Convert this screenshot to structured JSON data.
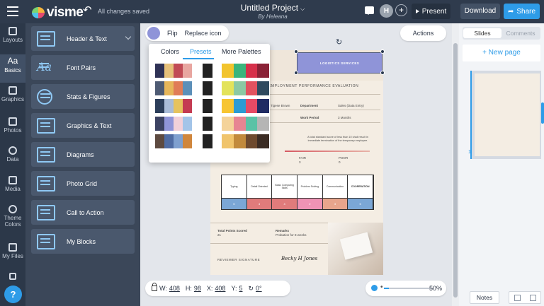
{
  "topbar": {
    "logo_text": "visme",
    "save_status": "All changes saved",
    "project_title": "Untitled Project",
    "project_author": "By Heleana",
    "avatar_initial": "H",
    "present_label": "Present",
    "download_label": "Download",
    "share_label": "Share"
  },
  "sidebar": {
    "items": [
      {
        "label": "Layouts"
      },
      {
        "label": "Basics"
      },
      {
        "label": "Graphics"
      },
      {
        "label": "Photos"
      },
      {
        "label": "Data"
      },
      {
        "label": "Media"
      },
      {
        "label": "Theme Colors"
      },
      {
        "label": "My Files"
      }
    ],
    "help_label": "?"
  },
  "panel": {
    "cards": [
      {
        "label": "Header & Text"
      },
      {
        "label": "Font Pairs"
      },
      {
        "label": "Stats & Figures"
      },
      {
        "label": "Graphics & Text"
      },
      {
        "label": "Diagrams"
      },
      {
        "label": "Photo Grid"
      },
      {
        "label": "Call to Action"
      },
      {
        "label": "My Blocks"
      }
    ]
  },
  "toolbar": {
    "flip_label": "Flip",
    "replace_icon_label": "Replace icon",
    "actions_label": "Actions",
    "selected_color": "#8f94d8"
  },
  "color_popover": {
    "tabs": [
      "Colors",
      "Presets",
      "More Palettes"
    ],
    "active_tab": "Presets",
    "palettes": [
      {
        "left": [
          "#2f3256",
          "#e6c07a",
          "#c14b55",
          "#e8a6a0"
        ],
        "mid": [
          "#222222"
        ],
        "right": [
          "#f2c42d",
          "#3ab57c",
          "#d6304a",
          "#8a2236"
        ]
      },
      {
        "left": [
          "#4e5b74",
          "#e6b65a",
          "#e07c56",
          "#5c8fb8"
        ],
        "mid": [
          "#222222"
        ],
        "right": [
          "#e3e35a",
          "#8bc9a3",
          "#e2525f",
          "#2f4a5f"
        ]
      },
      {
        "left": [
          "#2c3e5a",
          "#a9bcd8",
          "#e6c35e",
          "#c43b52"
        ],
        "mid": [
          "#222222"
        ],
        "right": [
          "#f7c531",
          "#2c9bd3",
          "#e64a65",
          "#1f2b63"
        ]
      },
      {
        "left": [
          "#3c4262",
          "#8f94d8",
          "#f2d0d9",
          "#a3c4e8"
        ],
        "mid": [
          "#222222"
        ],
        "right": [
          "#f4d39a",
          "#e78592",
          "#5ac2a6",
          "#b5b5b5"
        ]
      },
      {
        "left": [
          "#5d4a40",
          "#4f6ca3",
          "#7fa0cf",
          "#d0863c"
        ],
        "mid": [
          "#222222"
        ],
        "right": [
          "#f0c46c",
          "#c28a3c",
          "#6e4a2e",
          "#3b2c24"
        ]
      }
    ]
  },
  "document": {
    "badge_text": "LOGISTICS SERVICES",
    "title": "EMPLOYMENT PERFORMANCE EVALUATION",
    "row1": {
      "c1": "Tigese Brown",
      "c2": "Department",
      "c3": "Sales (Data Entry)"
    },
    "row2": {
      "c2": "Work Period",
      "c3": "3 Months"
    },
    "note": "A total standard score of less than 10 shall result in immediate termination of the temporary employee.",
    "fair_label": "FAIR",
    "fair_val": "3",
    "poor_label": "POOR",
    "poor_val": "0",
    "table_headers": [
      "Typing",
      "Detail Oriented",
      "Basic Computing Skills",
      "Problem Solving",
      "Communication",
      "COOPERATION"
    ],
    "table_values": [
      "5",
      "4",
      "4",
      "2",
      "3",
      "5"
    ],
    "table_colors": [
      "#7ba7d6",
      "#e07b7b",
      "#e07b7b",
      "#ef93b5",
      "#e8a58c",
      "#7ba7d6"
    ],
    "total_label": "Total Points Scored",
    "total_val": "21",
    "remarks_label": "Remarks",
    "remarks_val": "Probation for 8 weeks",
    "reviewer_label": "REVIEWER SIGNATURE",
    "signature": "Becky H Jones"
  },
  "right_panel": {
    "tab_slides": "Slides",
    "tab_comments": "Comments",
    "new_page_label": "+ New page",
    "slide_number": "1",
    "notes_label": "Notes"
  },
  "dims": {
    "w_label": "W:",
    "w_val": "408",
    "h_label": "H:",
    "h_val": "98",
    "x_label": "X:",
    "x_val": "408",
    "y_label": "Y:",
    "y_val": "5",
    "rotate_val": "0°"
  },
  "zoom": {
    "value": "50%",
    "level": 0.5
  }
}
